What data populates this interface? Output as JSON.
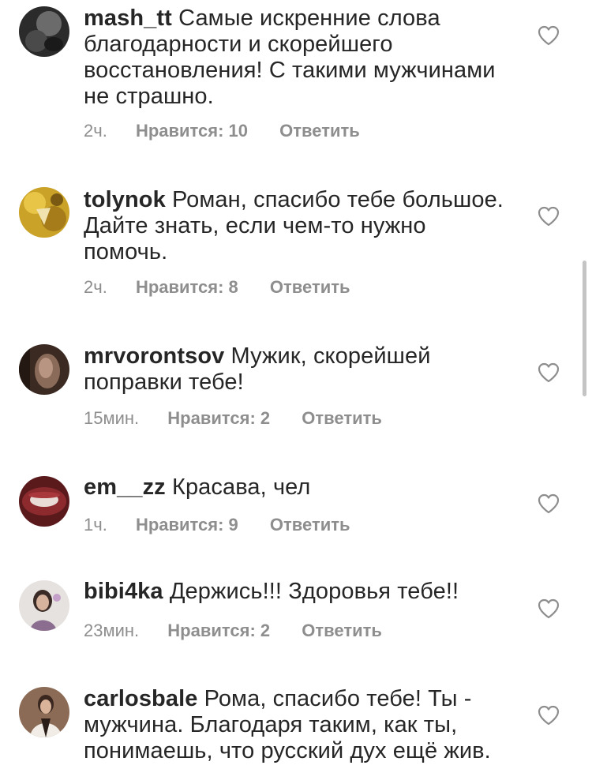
{
  "comments": [
    {
      "username": "mash_tt",
      "text": "Самые искренние слова благодарности и скорейшего восстановления! С такими мужчинами не страшно.",
      "time": "2ч.",
      "likes": "Нравится: 10",
      "reply": "Ответить",
      "avatar_icon": "avatar-dark"
    },
    {
      "username": "tolynok",
      "text": "Роман, спасибо тебе большое. Дайте знать, если чем-то нужно помочь.",
      "time": "2ч.",
      "likes": "Нравится: 8",
      "reply": "Ответить",
      "avatar_icon": "avatar-yellow"
    },
    {
      "username": "mrvorontsov",
      "text": "Мужик, скорейшей поправки тебе!",
      "time": "15мин.",
      "likes": "Нравится: 2",
      "reply": "Ответить",
      "avatar_icon": "avatar-brown"
    },
    {
      "username": "em__zz",
      "text": "Красава, чел",
      "time": "1ч.",
      "likes": "Нравится: 9",
      "reply": "Ответить",
      "avatar_icon": "avatar-red"
    },
    {
      "username": "bibi4ka",
      "text": "Держись!!! Здоровья тебе!!",
      "time": "23мин.",
      "likes": "Нравится: 2",
      "reply": "Ответить",
      "avatar_icon": "avatar-light"
    },
    {
      "username": "carlosbale",
      "text": "Рома, спасибо тебе! Ты - мужчина. Благодаря таким, как ты, понимаешь, что русский дух ещё жив.",
      "avatar_icon": "avatar-person"
    }
  ],
  "colors": {
    "text": "#262626",
    "meta": "#8e8e8e",
    "heart_stroke": "#8e8e8e",
    "scrollbar": "#c4c4c4"
  },
  "icons": {
    "like": "heart-outline-icon"
  }
}
